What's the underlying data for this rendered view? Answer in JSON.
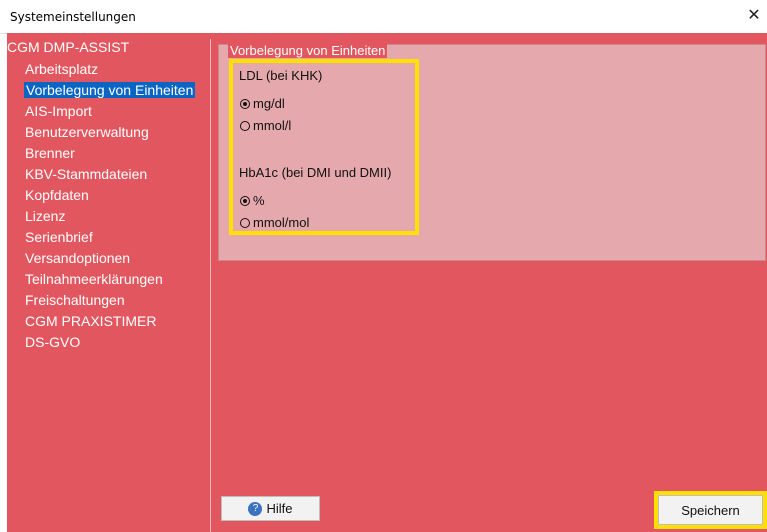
{
  "window": {
    "title": "Systemeinstellungen"
  },
  "sidebar": {
    "root": "CGM DMP-ASSIST",
    "items": [
      {
        "label": "Arbeitsplatz"
      },
      {
        "label": "Vorbelegung von Einheiten",
        "selected": true
      },
      {
        "label": "AIS-Import"
      },
      {
        "label": "Benutzerverwaltung"
      },
      {
        "label": "Brenner"
      },
      {
        "label": "KBV-Stammdateien"
      },
      {
        "label": "Kopfdaten"
      },
      {
        "label": "Lizenz"
      },
      {
        "label": "Serienbrief"
      },
      {
        "label": "Versandoptionen"
      },
      {
        "label": "Teilnahmeerklärungen"
      },
      {
        "label": "Freischaltungen"
      },
      {
        "label": "CGM PRAXISTIMER"
      },
      {
        "label": "DS-GVO"
      }
    ]
  },
  "main": {
    "group_title": "Vorbelegung von Einheiten",
    "ldl": {
      "label": "LDL (bei KHK)",
      "options": [
        "mg/dl",
        "mmol/l"
      ],
      "selected": "mg/dl"
    },
    "hba1c": {
      "label": "HbA1c (bei DMI und DMII)",
      "options": [
        "%",
        "mmol/mol"
      ],
      "selected": "%"
    }
  },
  "buttons": {
    "help": "Hilfe",
    "save": "Speichern"
  },
  "colors": {
    "panel": "#e2575f",
    "group": "#e5a9ad",
    "highlight": "#ffe000",
    "selection": "#0a66c2"
  }
}
